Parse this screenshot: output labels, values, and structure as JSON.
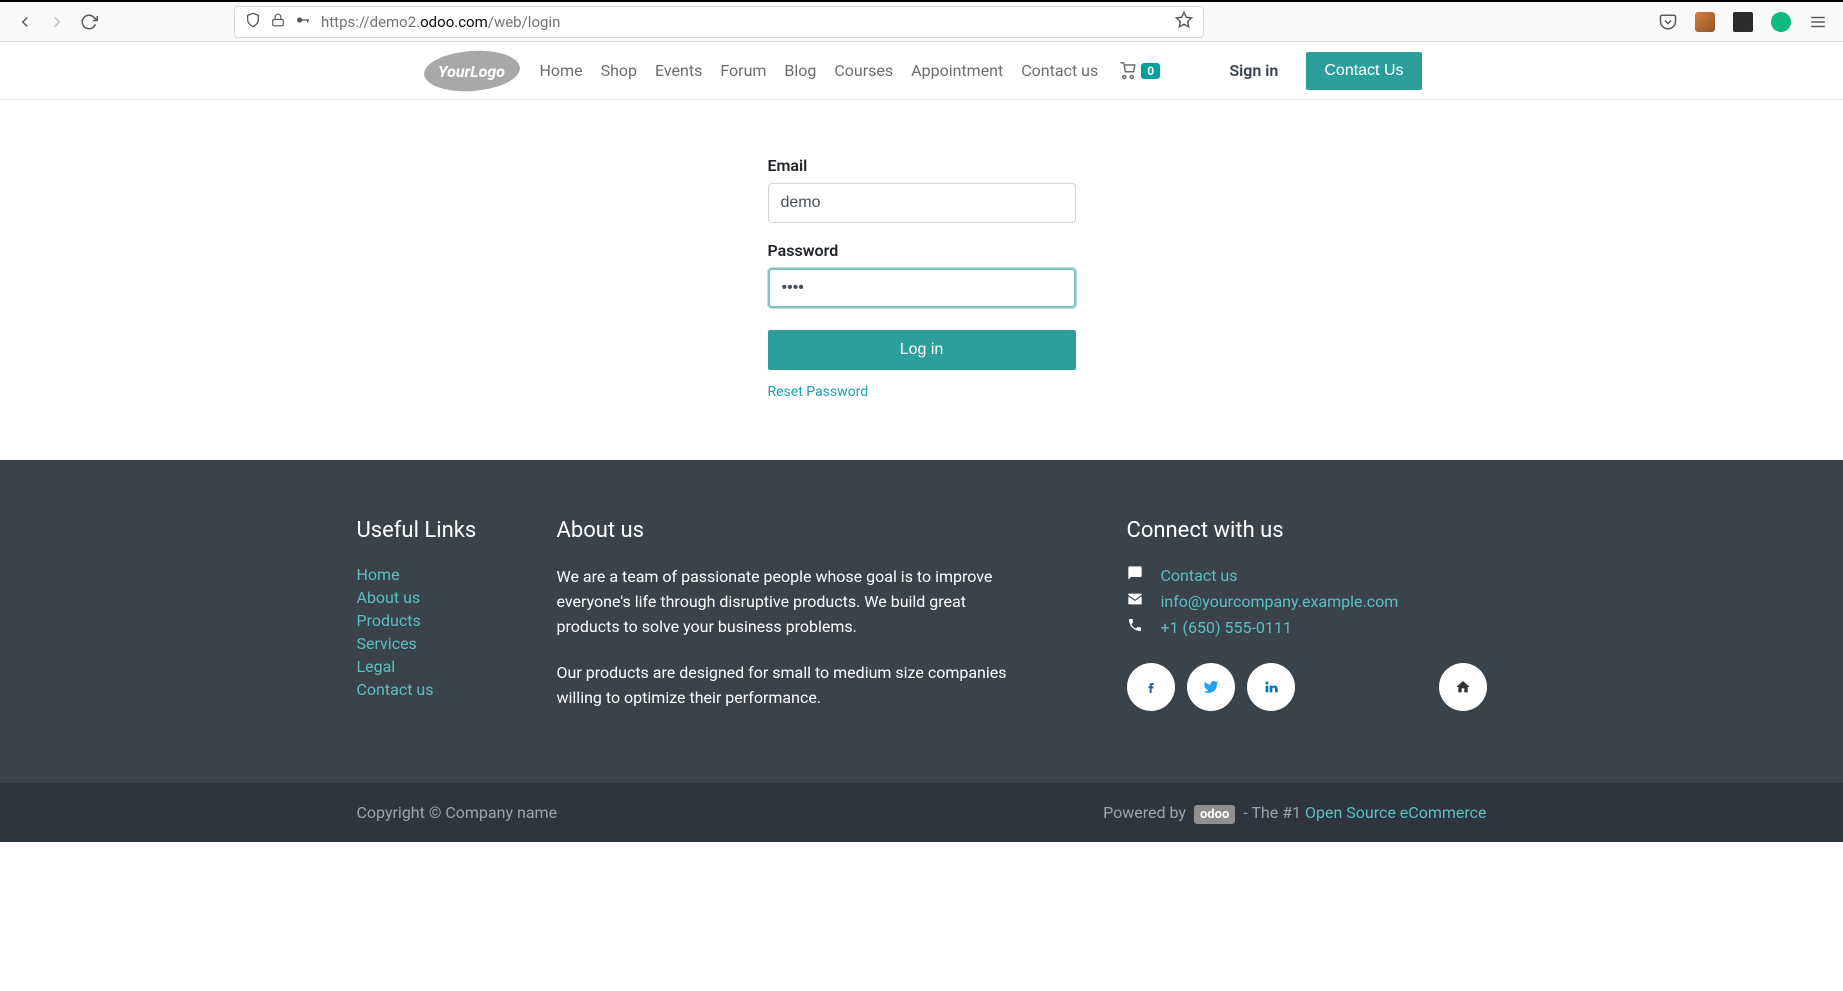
{
  "browser": {
    "url_prefix": "https://demo2.",
    "url_host": "odoo.com",
    "url_path": "/web/login"
  },
  "header": {
    "logo_text": "YourLogo",
    "nav": [
      "Home",
      "Shop",
      "Events",
      "Forum",
      "Blog",
      "Courses",
      "Appointment",
      "Contact us"
    ],
    "cart_count": "0",
    "signin": "Sign in",
    "contact_btn": "Contact Us"
  },
  "login": {
    "email_label": "Email",
    "email_value": "demo",
    "password_label": "Password",
    "password_value": "••••",
    "login_btn": "Log in",
    "reset_link": "Reset Password"
  },
  "footer": {
    "useful_title": "Useful Links",
    "useful_links": [
      "Home",
      "About us",
      "Products",
      "Services",
      "Legal",
      "Contact us"
    ],
    "about_title": "About us",
    "about_p1": "We are a team of passionate people whose goal is to improve everyone's life through disruptive products. We build great products to solve your business problems.",
    "about_p2": "Our products are designed for small to medium size companies willing to optimize their performance.",
    "connect_title": "Connect with us",
    "contact_us": "Contact us",
    "email": "info@yourcompany.example.com",
    "phone": "+1 (650) 555-0111"
  },
  "bottombar": {
    "copyright": "Copyright © Company name",
    "powered_by": "Powered by",
    "odoo": "odoo",
    "dash": " - The #1 ",
    "tagline_link": "Open Source eCommerce"
  }
}
